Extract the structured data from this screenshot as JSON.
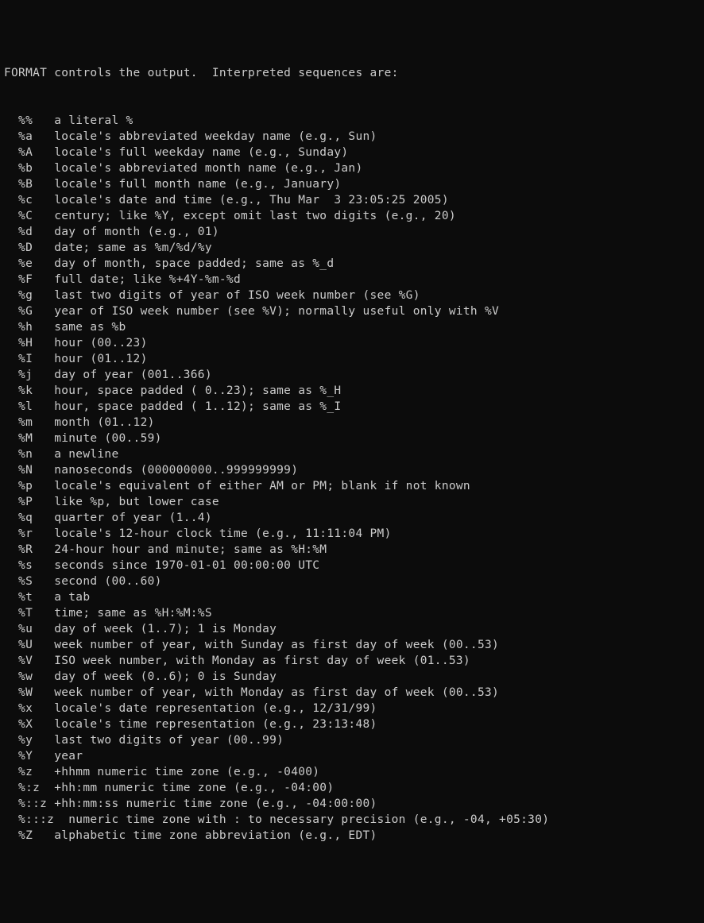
{
  "intro": "FORMAT controls the output.  Interpreted sequences are:",
  "entries": [
    {
      "code": "%%",
      "desc": "a literal %"
    },
    {
      "code": "%a",
      "desc": "locale's abbreviated weekday name (e.g., Sun)"
    },
    {
      "code": "%A",
      "desc": "locale's full weekday name (e.g., Sunday)"
    },
    {
      "code": "%b",
      "desc": "locale's abbreviated month name (e.g., Jan)"
    },
    {
      "code": "%B",
      "desc": "locale's full month name (e.g., January)"
    },
    {
      "code": "%c",
      "desc": "locale's date and time (e.g., Thu Mar  3 23:05:25 2005)"
    },
    {
      "code": "%C",
      "desc": "century; like %Y, except omit last two digits (e.g., 20)"
    },
    {
      "code": "%d",
      "desc": "day of month (e.g., 01)"
    },
    {
      "code": "%D",
      "desc": "date; same as %m/%d/%y"
    },
    {
      "code": "%e",
      "desc": "day of month, space padded; same as %_d"
    },
    {
      "code": "%F",
      "desc": "full date; like %+4Y-%m-%d"
    },
    {
      "code": "%g",
      "desc": "last two digits of year of ISO week number (see %G)"
    },
    {
      "code": "%G",
      "desc": "year of ISO week number (see %V); normally useful only with %V"
    },
    {
      "code": "%h",
      "desc": "same as %b"
    },
    {
      "code": "%H",
      "desc": "hour (00..23)"
    },
    {
      "code": "%I",
      "desc": "hour (01..12)"
    },
    {
      "code": "%j",
      "desc": "day of year (001..366)"
    },
    {
      "code": "%k",
      "desc": "hour, space padded ( 0..23); same as %_H"
    },
    {
      "code": "%l",
      "desc": "hour, space padded ( 1..12); same as %_I"
    },
    {
      "code": "%m",
      "desc": "month (01..12)"
    },
    {
      "code": "%M",
      "desc": "minute (00..59)"
    },
    {
      "code": "%n",
      "desc": "a newline"
    },
    {
      "code": "%N",
      "desc": "nanoseconds (000000000..999999999)"
    },
    {
      "code": "%p",
      "desc": "locale's equivalent of either AM or PM; blank if not known"
    },
    {
      "code": "%P",
      "desc": "like %p, but lower case"
    },
    {
      "code": "%q",
      "desc": "quarter of year (1..4)"
    },
    {
      "code": "%r",
      "desc": "locale's 12-hour clock time (e.g., 11:11:04 PM)"
    },
    {
      "code": "%R",
      "desc": "24-hour hour and minute; same as %H:%M"
    },
    {
      "code": "%s",
      "desc": "seconds since 1970-01-01 00:00:00 UTC"
    },
    {
      "code": "%S",
      "desc": "second (00..60)"
    },
    {
      "code": "%t",
      "desc": "a tab"
    },
    {
      "code": "%T",
      "desc": "time; same as %H:%M:%S"
    },
    {
      "code": "%u",
      "desc": "day of week (1..7); 1 is Monday"
    },
    {
      "code": "%U",
      "desc": "week number of year, with Sunday as first day of week (00..53)"
    },
    {
      "code": "%V",
      "desc": "ISO week number, with Monday as first day of week (01..53)"
    },
    {
      "code": "%w",
      "desc": "day of week (0..6); 0 is Sunday"
    },
    {
      "code": "%W",
      "desc": "week number of year, with Monday as first day of week (00..53)"
    },
    {
      "code": "%x",
      "desc": "locale's date representation (e.g., 12/31/99)"
    },
    {
      "code": "%X",
      "desc": "locale's time representation (e.g., 23:13:48)"
    },
    {
      "code": "%y",
      "desc": "last two digits of year (00..99)"
    },
    {
      "code": "%Y",
      "desc": "year"
    },
    {
      "code": "%z",
      "desc": "+hhmm numeric time zone (e.g., -0400)"
    },
    {
      "code": "%:z",
      "desc": "+hh:mm numeric time zone (e.g., -04:00)"
    },
    {
      "code": "%::z",
      "desc": "+hh:mm:ss numeric time zone (e.g., -04:00:00)"
    },
    {
      "code": "%:::z",
      "desc": "numeric time zone with : to necessary precision (e.g., -04, +05:30)"
    },
    {
      "code": "%Z",
      "desc": "alphabetic time zone abbreviation (e.g., EDT)"
    }
  ]
}
